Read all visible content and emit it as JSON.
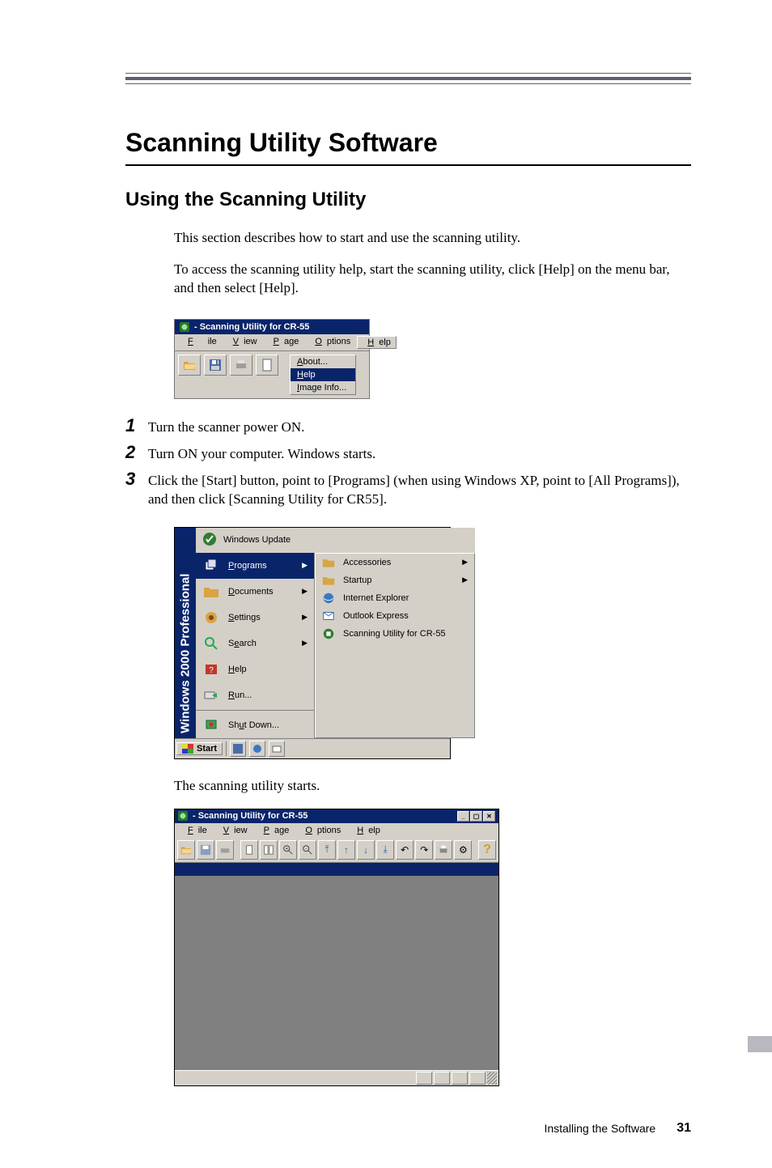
{
  "headings": {
    "h1": "Scanning Utility Software",
    "h2": "Using the Scanning Utility"
  },
  "paragraphs": {
    "intro1": "This section describes how to start and use the scanning utility.",
    "intro2": "To access the scanning utility help, start the scanning utility, click  [Help] on the menu bar, and then select [Help].",
    "result": "The scanning utility starts."
  },
  "steps": {
    "s1": "Turn the scanner power ON.",
    "s2": "Turn ON your computer. Windows starts.",
    "s3": "Click the [Start] button, point to [Programs] (when using Windows XP, point to [All Programs]), and then click [Scanning Utility for CR55]."
  },
  "screenshot1": {
    "title": "- Scanning Utility for CR-55",
    "menus": {
      "file": "File",
      "view": "View",
      "page": "Page",
      "options": "Options",
      "help": "Help"
    },
    "help_menu": {
      "about": "About...",
      "help": "Help",
      "image_info": "Image Info..."
    }
  },
  "screenshot2": {
    "os_vertical_main": "Professional",
    "os_vertical_sub": "Windows 2000",
    "top_item": "Windows Update",
    "col1": {
      "programs": "Programs",
      "documents": "Documents",
      "settings": "Settings",
      "search": "Search",
      "help": "Help",
      "run": "Run...",
      "shutdown": "Shut Down..."
    },
    "col2": {
      "accessories": "Accessories",
      "startup": "Startup",
      "ie": "Internet Explorer",
      "outlook": "Outlook Express",
      "scanutil": "Scanning Utility for CR-55"
    },
    "start_button": "Start"
  },
  "screenshot3": {
    "title": "- Scanning Utility for CR-55",
    "menus": {
      "file": "File",
      "view": "View",
      "page": "Page",
      "options": "Options",
      "help": "Help"
    }
  },
  "footer": {
    "section": "Installing the Software",
    "page": "31"
  }
}
